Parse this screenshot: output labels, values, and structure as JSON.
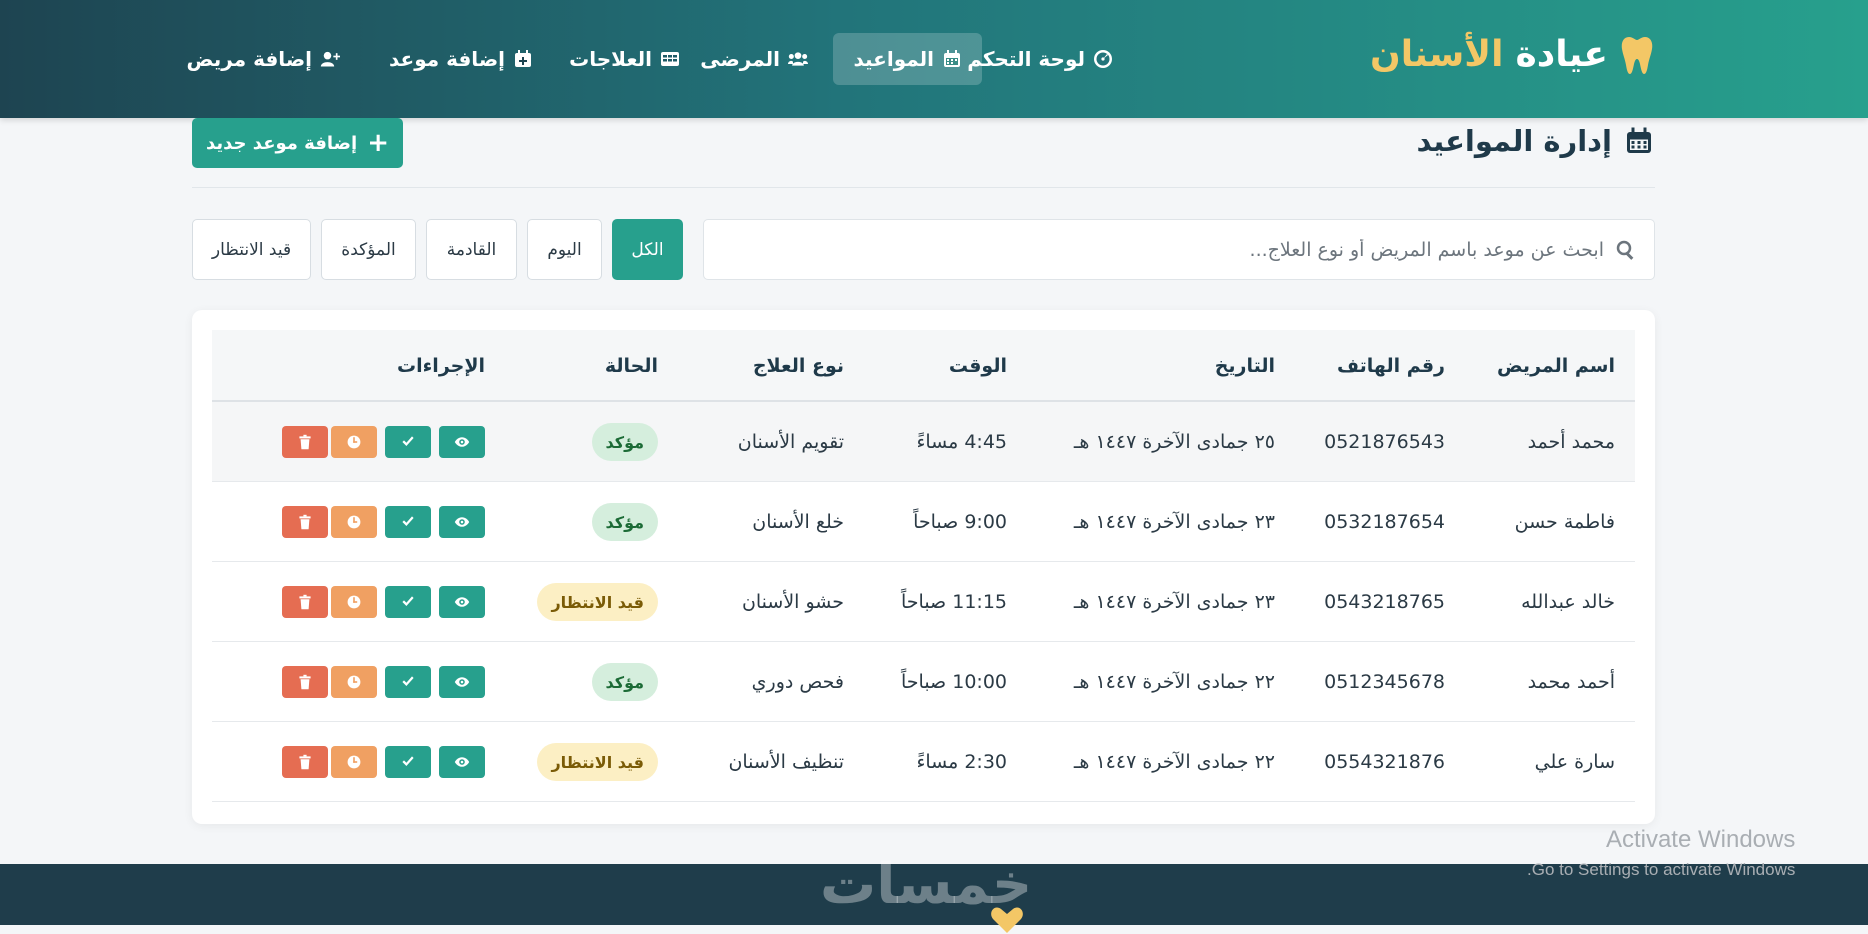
{
  "brand": {
    "name_part1": "عيادة",
    "name_part2": "الأسنان",
    "icon": "tooth-icon"
  },
  "nav": [
    {
      "label": "لوحة التحكم",
      "icon": "dashboard-icon",
      "active": false
    },
    {
      "label": "المواعيد",
      "icon": "calendar-icon",
      "active": true
    },
    {
      "label": "المرضى",
      "icon": "users-icon",
      "active": false
    },
    {
      "label": "العلاجات",
      "icon": "table-icon",
      "active": false
    },
    {
      "label": "إضافة موعد",
      "icon": "calendar-plus-icon",
      "active": false
    },
    {
      "label": "إضافة مريض",
      "icon": "user-plus-icon",
      "active": false
    }
  ],
  "page": {
    "title": "إدارة المواعيد",
    "add_button": "إضافة موعد جديد"
  },
  "search": {
    "placeholder": "ابحث عن موعد باسم المريض أو نوع العلاج..."
  },
  "filters": [
    {
      "label": "الكل",
      "active": true
    },
    {
      "label": "اليوم",
      "active": false
    },
    {
      "label": "القادمة",
      "active": false
    },
    {
      "label": "المؤكدة",
      "active": false
    },
    {
      "label": "قيد الانتظار",
      "active": false
    }
  ],
  "table": {
    "columns": [
      "اسم المريض",
      "رقم الهاتف",
      "التاريخ",
      "الوقت",
      "نوع العلاج",
      "الحالة",
      "الإجراءات"
    ],
    "rows": [
      {
        "name": "محمد أحمد",
        "phone": "0521876543",
        "date": "٢٥ جمادى الآخرة ١٤٤٧ هـ",
        "time": "4:45 مساءً",
        "treatment": "تقويم الأسنان",
        "status": "مؤكد",
        "status_type": "confirmed"
      },
      {
        "name": "فاطمة حسن",
        "phone": "0532187654",
        "date": "٢٣ جمادى الآخرة ١٤٤٧ هـ",
        "time": "9:00 صباحاً",
        "treatment": "خلع الأسنان",
        "status": "مؤكد",
        "status_type": "confirmed"
      },
      {
        "name": "خالد عبدالله",
        "phone": "0543218765",
        "date": "٢٣ جمادى الآخرة ١٤٤٧ هـ",
        "time": "11:15 صباحاً",
        "treatment": "حشو الأسنان",
        "status": "قيد الانتظار",
        "status_type": "pending"
      },
      {
        "name": "أحمد محمد",
        "phone": "0512345678",
        "date": "٢٢ جمادى الآخرة ١٤٤٧ هـ",
        "time": "10:00 صباحاً",
        "treatment": "فحص دوري",
        "status": "مؤكد",
        "status_type": "confirmed"
      },
      {
        "name": "سارة علي",
        "phone": "0554321876",
        "date": "٢٢ جمادى الآخرة ١٤٤٧ هـ",
        "time": "2:30 مساءً",
        "treatment": "تنظيف الأسنان",
        "status": "قيد الانتظار",
        "status_type": "pending"
      }
    ]
  },
  "watermark": {
    "line1": "Activate Windows",
    "line2": "Go to Settings to activate Windows."
  },
  "footer": {
    "logo_text": "خمسات"
  },
  "colors": {
    "primary": "#27a08d",
    "accent": "#f3c766",
    "dark": "#1f3d4b",
    "warning": "#f0a062",
    "danger": "#e56d52"
  }
}
